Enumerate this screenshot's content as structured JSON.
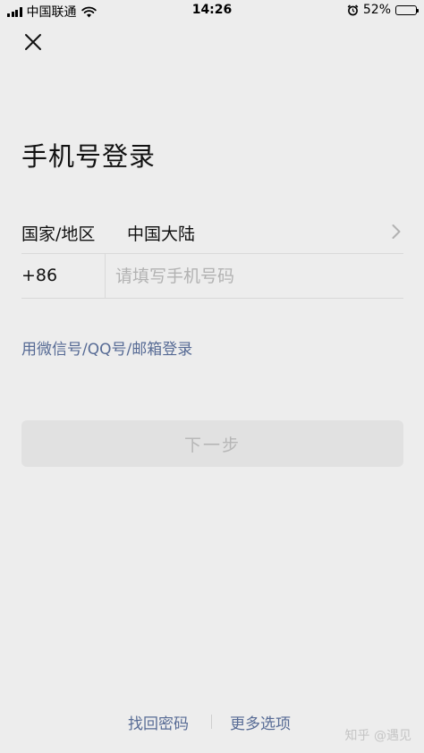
{
  "status_bar": {
    "carrier": "中国联通",
    "time": "14:26",
    "battery": "52%",
    "battery_level": 0.52
  },
  "header": {
    "title": "手机号登录"
  },
  "region": {
    "label": "国家/地区",
    "value": "中国大陆"
  },
  "phone": {
    "country_code": "+86",
    "placeholder": "请填写手机号码",
    "value": ""
  },
  "alt_login": "用微信号/QQ号/邮箱登录",
  "next_button": "下一步",
  "footer": {
    "find_password": "找回密码",
    "more_options": "更多选项"
  },
  "watermark": "知乎 @遇见",
  "colors": {
    "background": "#ededed",
    "link": "#576b95",
    "disabled_button": "#e1e1e1",
    "disabled_text": "#b6b6b6"
  }
}
